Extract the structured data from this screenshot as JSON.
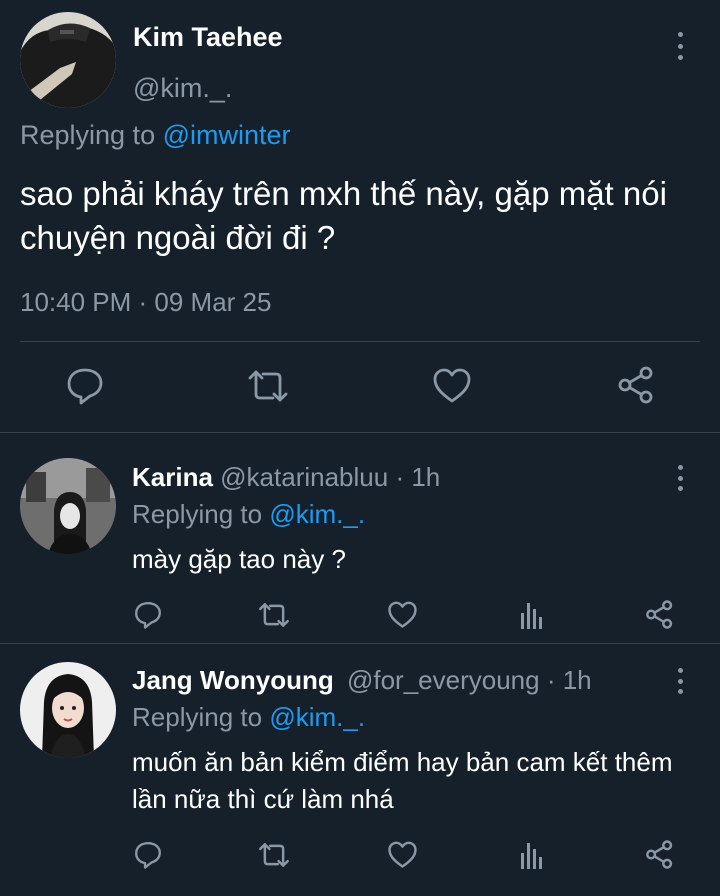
{
  "main_tweet": {
    "display_name": "Kim Taehee",
    "handle": "@kim._.",
    "replying_prefix": "Replying to ",
    "replying_handle": "@imwinter",
    "text": "sao phải kháy trên mxh thế này, gặp mặt nói chuyện ngoài đời đi ?",
    "timestamp": "10:40 PM · 09 Mar 25",
    "actions": [
      "reply-icon",
      "retweet-icon",
      "like-icon",
      "share-icon"
    ]
  },
  "replies": [
    {
      "display_name": "Karina",
      "handle": "@katarinabluu",
      "time": " · 1h",
      "replying_prefix": "Replying to ",
      "replying_handle": "@kim._.",
      "text": "mày gặp tao này ?"
    },
    {
      "display_name": "Jang Wonyoung",
      "handle": "@for_everyoung",
      "time": " · 1h",
      "replying_prefix": "Replying to ",
      "replying_handle": "@kim._.",
      "text": "muốn ăn bản kiểm điểm hay bản cam kết thêm lần nữa thì cứ làm nhá"
    }
  ],
  "reply_actions": [
    "reply-icon",
    "retweet-icon",
    "like-icon",
    "analytics-icon",
    "share-icon"
  ],
  "colors": {
    "background": "#15202b",
    "text": "#ffffff",
    "muted": "#8b98a5",
    "link": "#1d9bf0",
    "divider": "#38444d"
  }
}
